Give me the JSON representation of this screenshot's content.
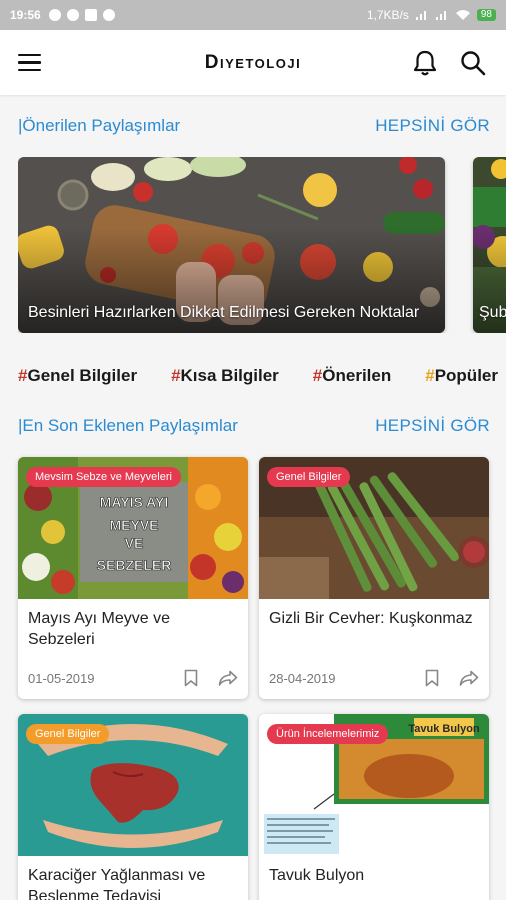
{
  "status_bar": {
    "time": "19:56",
    "network_speed": "1,7KB/s",
    "battery": "98"
  },
  "app_bar": {
    "title": "Diyetoloji",
    "icons": [
      "menu-icon",
      "bell-icon",
      "search-icon"
    ]
  },
  "featured": {
    "title": "|Önerilen Paylaşımlar",
    "see_all": "HEPSİNİ GÖR",
    "items": [
      {
        "caption": "Besinleri Hazırlarken Dikkat Edilmesi Gereken Noktalar"
      },
      {
        "caption": "Şub"
      }
    ]
  },
  "tags": [
    {
      "hash": "#",
      "label": "Genel Bilgiler"
    },
    {
      "hash": "#",
      "label": "Kısa Bilgiler"
    },
    {
      "hash": "#",
      "label": "Önerilen"
    },
    {
      "hash": "#",
      "label": "Popüler"
    }
  ],
  "latest": {
    "title": "|En Son Eklenen Paylaşımlar",
    "see_all": "HEPSİNİ GÖR",
    "posts": [
      {
        "category": "Mevsim Sebze ve Meyveleri",
        "image_text": "MAYIS AYI MEYVE VE SEBZELER",
        "title": "Mayıs Ayı Meyve ve Sebzeleri",
        "date": "01-05-2019",
        "badge_color": "#e53950"
      },
      {
        "category": "Genel Bilgiler",
        "title": "Gizli Bir Cevher: Kuşkonmaz",
        "date": "28-04-2019",
        "badge_color": "#e53950"
      },
      {
        "category": "Genel Bilgiler",
        "title": "Karaciğer Yağlanması ve Beslenme Tedavisi",
        "badge_color": "#f39c2a"
      },
      {
        "category": "Ürün İncelemelerimiz",
        "image_text": "Tavuk Bulyon",
        "title": "Tavuk Bulyon",
        "badge_color": "#e53950"
      }
    ]
  },
  "colors": {
    "accent": "#2a8bd2",
    "hash_red": "#c0392b",
    "hash_gold": "#e6a21a",
    "badge_red": "#e53950",
    "badge_orange": "#f39c2a"
  }
}
